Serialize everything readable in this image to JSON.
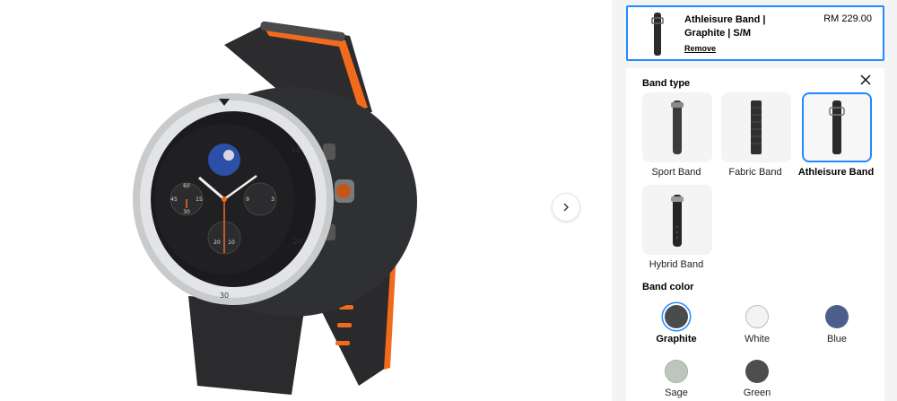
{
  "cart": {
    "item_name": "Athleisure Band | Graphite | S/M",
    "price": "RM 229.00",
    "remove_label": "Remove"
  },
  "band_type": {
    "title": "Band type",
    "options": [
      {
        "label": "Sport Band",
        "icon": "sport-band-icon"
      },
      {
        "label": "Fabric Band",
        "icon": "fabric-band-icon"
      },
      {
        "label": "Athleisure Band",
        "icon": "athleisure-band-icon"
      },
      {
        "label": "Hybrid Band",
        "icon": "hybrid-band-icon"
      }
    ],
    "selected": "Athleisure Band"
  },
  "band_color": {
    "title": "Band color",
    "options": [
      {
        "label": "Graphite",
        "color": "#4a4b4d"
      },
      {
        "label": "White",
        "color": "#f3f3f1"
      },
      {
        "label": "Blue",
        "color": "#4c5f8c"
      },
      {
        "label": "Sage",
        "color": "#bcc6bd"
      },
      {
        "label": "Green",
        "color": "#4b4e4a"
      }
    ],
    "selected": "Graphite"
  },
  "colors": {
    "accent": "#2189ff",
    "band_orange": "#f26b1d"
  },
  "icons": {
    "next": "chevron-right-icon",
    "close": "close-icon"
  },
  "watch_face": {
    "bezel_numbers": [
      "10",
      "20",
      "30"
    ],
    "subdial_numbers": [
      "60",
      "45",
      "30",
      "15",
      "3",
      "9",
      "20",
      "10"
    ]
  }
}
